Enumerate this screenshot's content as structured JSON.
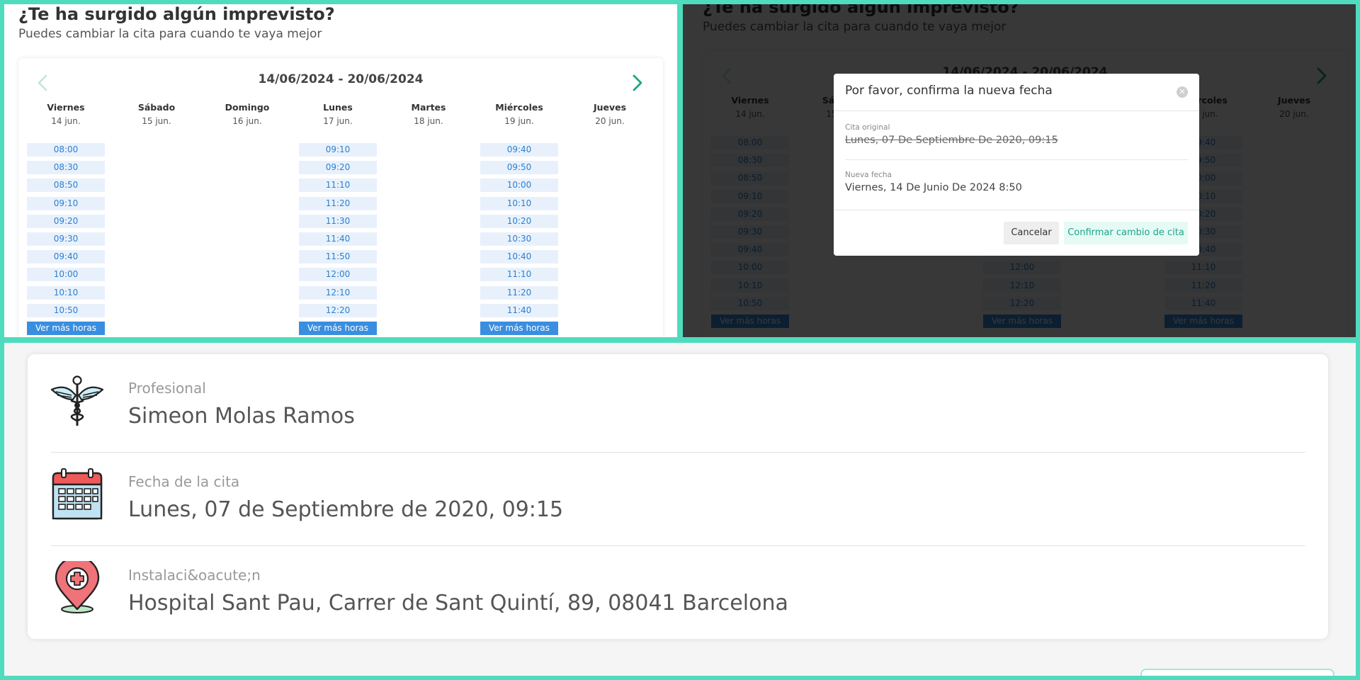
{
  "scheduler": {
    "title": "¿Te ha surgido algún imprevisto?",
    "subtitle": "Puedes cambiar la cita para cuando te vaya mejor",
    "date_range": "14/06/2024 - 20/06/2024",
    "more_label": "Ver más horas",
    "days": [
      {
        "name": "Viernes",
        "date": "14 jun.",
        "slots": [
          "08:00",
          "08:30",
          "08:50",
          "09:10",
          "09:20",
          "09:30",
          "09:40",
          "10:00",
          "10:10",
          "10:50"
        ]
      },
      {
        "name": "Sábado",
        "date": "15 jun.",
        "slots": []
      },
      {
        "name": "Domingo",
        "date": "16 jun.",
        "slots": []
      },
      {
        "name": "Lunes",
        "date": "17 jun.",
        "slots": [
          "09:10",
          "09:20",
          "11:10",
          "11:20",
          "11:30",
          "11:40",
          "11:50",
          "12:00",
          "12:10",
          "12:20"
        ]
      },
      {
        "name": "Martes",
        "date": "18 jun.",
        "slots": []
      },
      {
        "name": "Miércoles",
        "date": "19 jun.",
        "slots": [
          "09:40",
          "09:50",
          "10:00",
          "10:10",
          "10:20",
          "10:30",
          "10:40",
          "11:10",
          "11:20",
          "11:40"
        ]
      },
      {
        "name": "Jueves",
        "date": "20 jun.",
        "slots": []
      }
    ]
  },
  "modal": {
    "title": "Por favor, confirma la nueva fecha",
    "original_label": "Cita original",
    "original_value": "Lunes, 07 De Septiembre De 2020, 09:15",
    "new_label": "Nueva fecha",
    "new_value": "Viernes, 14 De Junio De 2024 8:50",
    "cancel_label": "Cancelar",
    "confirm_label": "Confirmar cambio de cita"
  },
  "details": {
    "professional_label": "Profesional",
    "professional_value": "Simeon Molas Ramos",
    "date_label": "Fecha de la cita",
    "date_value": "Lunes, 07 de Septiembre de 2020, 09:15",
    "location_label": "Instalaci&oacute;n",
    "location_value": "Hospital Sant Pau, Carrer de Sant Quintí, 89, 08041 Barcelona"
  },
  "colors": {
    "frame": "#4fdcbe",
    "accent_teal": "#1da585",
    "slot_bg": "#e8f1fb",
    "slot_text": "#2d7fcf",
    "more_button": "#3a8ee0"
  },
  "icons": {
    "prev": "chevron-left-icon",
    "next": "chevron-right-icon",
    "close": "close-circle-icon",
    "professional": "caduceus-icon",
    "date": "calendar-icon",
    "location": "location-pin-cross-icon"
  }
}
